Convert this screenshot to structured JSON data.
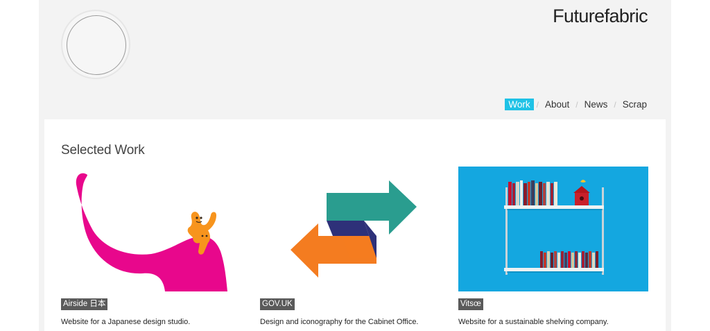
{
  "header": {
    "brand": "Futurefabric",
    "nav": [
      {
        "label": "Work",
        "active": true
      },
      {
        "label": "About",
        "active": false
      },
      {
        "label": "News",
        "active": false
      },
      {
        "label": "Scrap",
        "active": false
      }
    ],
    "nav_separator": "/",
    "accent_color": "#1fc2e6"
  },
  "main": {
    "title": "Selected Work",
    "projects": [
      {
        "tag": "Airside 日本",
        "description": "Website for a Japanese design studio.",
        "image": "pink-creature-illustration"
      },
      {
        "tag": "GOV.UK",
        "description": "Design and iconography for the Cabinet Office.",
        "image": "exchange-arrows-icon"
      },
      {
        "tag": "Vitsœ",
        "description": "Website for a sustainable shelving company.",
        "image": "shelving-photo"
      }
    ]
  }
}
